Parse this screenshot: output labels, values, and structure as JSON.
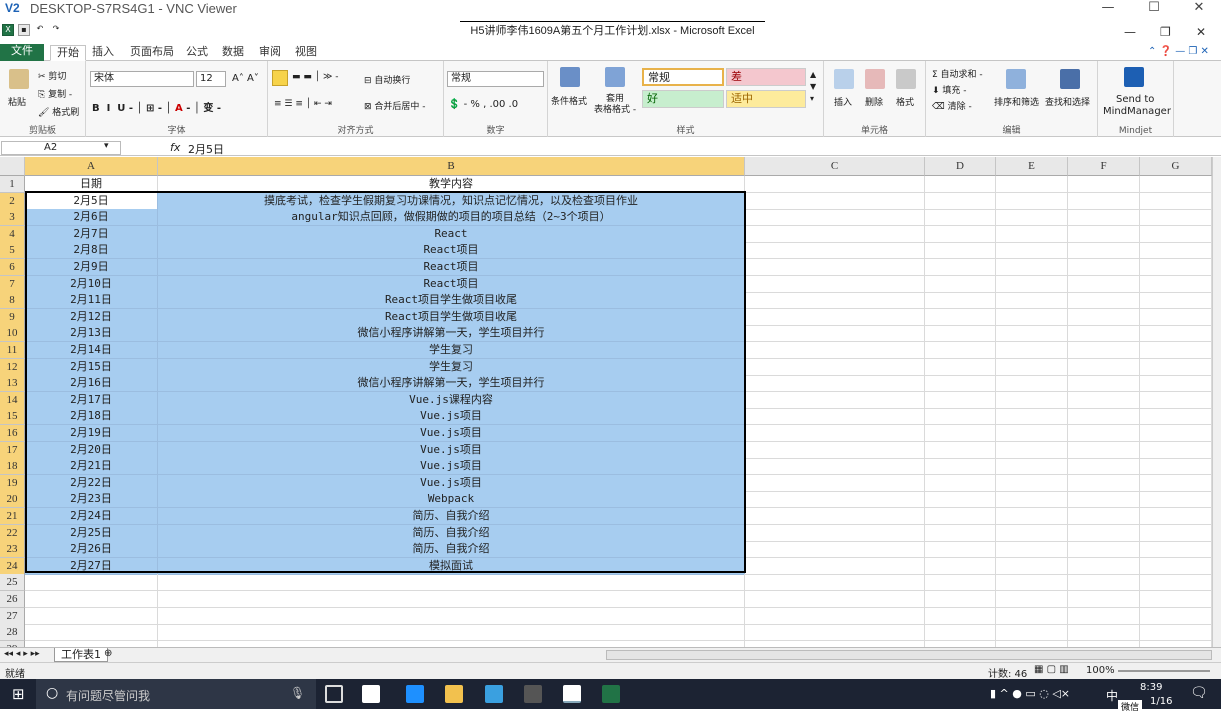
{
  "vnc": {
    "logo": "V2",
    "title": "DESKTOP-S7RS4G1 - VNC Viewer",
    "min": "—",
    "max": "☐",
    "close": "✕"
  },
  "excel": {
    "doc_title": "H5讲师李伟1609A第五个月工作计划.xlsx - Microsoft Excel",
    "tabs": [
      "文件",
      "开始",
      "插入",
      "页面布局",
      "公式",
      "数据",
      "审阅",
      "视图"
    ],
    "ribbon": {
      "clipboard": {
        "paste": "粘贴",
        "cut": "剪切",
        "copy": "复制 -",
        "format_painter": "格式刷",
        "label": "剪贴板"
      },
      "font": {
        "name": "宋体",
        "size": "12",
        "label": "字体"
      },
      "align": {
        "wrap": "自动换行",
        "merge": "合并后居中 -",
        "label": "对齐方式"
      },
      "number": {
        "format": "常规",
        "label": "数字"
      },
      "styles": {
        "cond": "条件格式",
        "table": "套用\n表格格式 -",
        "normal": "常规",
        "bad": "差",
        "good": "好",
        "neutral": "适中",
        "label": "样式"
      },
      "cells": {
        "insert": "插入",
        "delete": "删除",
        "format": "格式",
        "label": "单元格"
      },
      "editing": {
        "autosum": "Σ 自动求和 -",
        "fill": "填充 -",
        "clear": "清除 -",
        "sort": "排序和筛选",
        "find": "查找和选择",
        "label": "编辑"
      },
      "mindjet": {
        "send1": "Send to",
        "send2": "MindManager",
        "label": "Mindjet"
      }
    },
    "namebox": "A2",
    "formula": "2月5日",
    "columns": [
      "A",
      "B",
      "C",
      "D",
      "E",
      "F",
      "G"
    ],
    "header": {
      "a": "日期",
      "b": "教学内容"
    },
    "rows": [
      [
        "2月5日",
        "摸底考试，检查学生假期复习功课情况，知识点记忆情况，以及检查项目作业"
      ],
      [
        "2月6日",
        "angular知识点回顾，做假期做的项目的项目总结（2~3个项目）"
      ],
      [
        "2月7日",
        "React"
      ],
      [
        "2月8日",
        "React项目"
      ],
      [
        "2月9日",
        "React项目"
      ],
      [
        "2月10日",
        "React项目"
      ],
      [
        "2月11日",
        "React项目学生做项目收尾"
      ],
      [
        "2月12日",
        "React项目学生做项目收尾"
      ],
      [
        "2月13日",
        "微信小程序讲解第一天，学生项目并行"
      ],
      [
        "2月14日",
        "学生复习"
      ],
      [
        "2月15日",
        "学生复习"
      ],
      [
        "2月16日",
        "微信小程序讲解第一天，学生项目并行"
      ],
      [
        "2月17日",
        "Vue.js课程内容"
      ],
      [
        "2月18日",
        "Vue.js项目"
      ],
      [
        "2月19日",
        "Vue.js项目"
      ],
      [
        "2月20日",
        "Vue.js项目"
      ],
      [
        "2月21日",
        "Vue.js项目"
      ],
      [
        "2月22日",
        "Vue.js项目"
      ],
      [
        "2月23日",
        "Webpack"
      ],
      [
        "2月24日",
        "简历、自我介绍"
      ],
      [
        "2月25日",
        "简历、自我介绍"
      ],
      [
        "2月26日",
        "简历、自我介绍"
      ],
      [
        "2月27日",
        "模拟面试"
      ]
    ],
    "extra_rows": [
      "25",
      "26",
      "27",
      "28",
      "29"
    ],
    "sheet_tab": "工作表1",
    "status": {
      "ready": "就绪",
      "count": "计数: 46",
      "zoom": "100%"
    }
  },
  "taskbar": {
    "search": "有问题尽管问我",
    "time": "8:39",
    "date": "1/16",
    "lang": "中",
    "wechat": "微信"
  }
}
